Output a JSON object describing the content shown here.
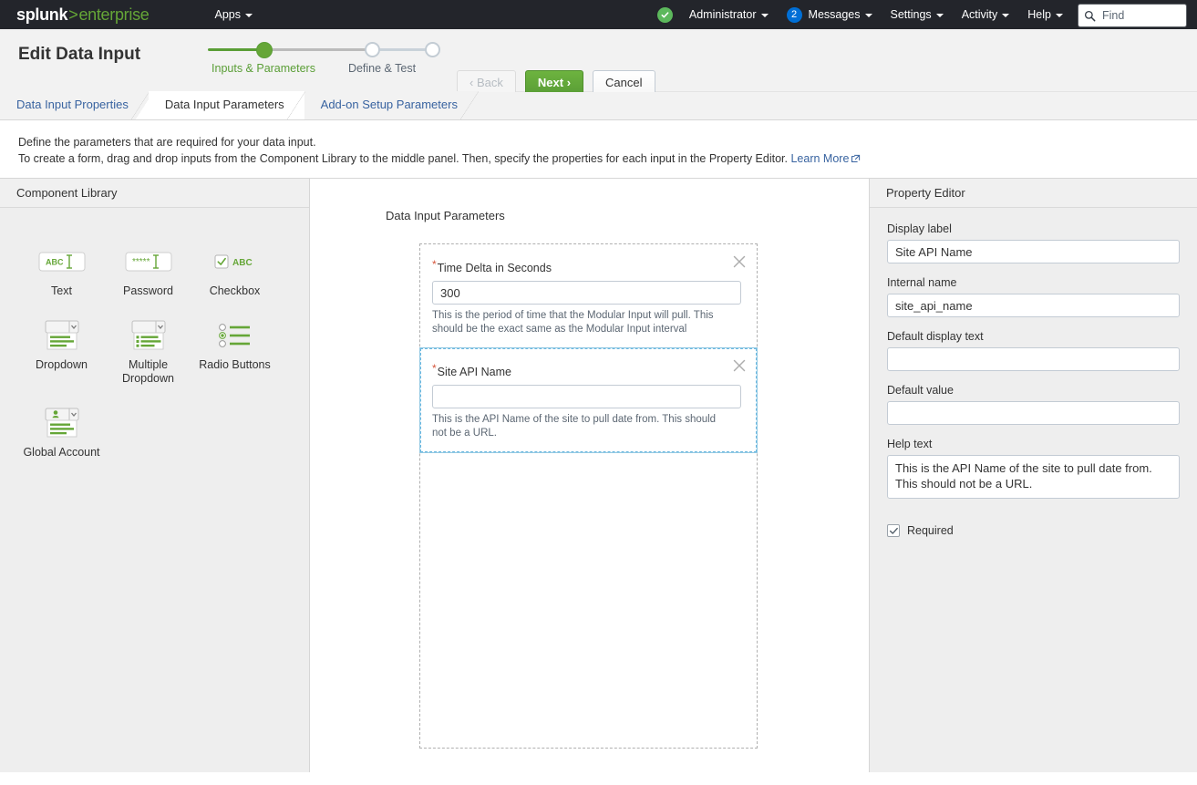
{
  "topbar": {
    "brand_splunk": "splunk",
    "brand_gt": ">",
    "brand_enterprise": "enterprise",
    "apps_label": "Apps",
    "health_icon": "health-check-icon",
    "administrator_label": "Administrator",
    "messages_count": "2",
    "messages_label": "Messages",
    "settings_label": "Settings",
    "activity_label": "Activity",
    "help_label": "Help",
    "find_placeholder": "Find",
    "find_value": "",
    "find_icon": "search-icon",
    "accent_green": "#65a637",
    "badge_blue": "#006fd6",
    "bar_bg": "#23252b"
  },
  "header": {
    "title": "Edit Data Input",
    "wizard": {
      "step_one_label": "Inputs & Parameters",
      "step_two_label": "Define & Test",
      "active_step": 1
    },
    "buttons": {
      "back": "Back",
      "next": "Next",
      "cancel": "Cancel",
      "back_chevron": "‹",
      "next_chevron": "›"
    }
  },
  "tabs": [
    {
      "label": "Data Input Properties",
      "active": false
    },
    {
      "label": "Data Input Parameters",
      "active": true
    },
    {
      "label": "Add-on Setup Parameters",
      "active": false
    }
  ],
  "description": {
    "line1": "Define the parameters that are required for your data input.",
    "line2": "To create a form, drag and drop inputs from the Component Library to the middle panel. Then, specify the properties for each input in the Property Editor.",
    "learn_more": "Learn More",
    "external_link_icon": "external-link-icon"
  },
  "component_library": {
    "title": "Component Library",
    "items": [
      {
        "label": "Text",
        "icon": "text-input-icon"
      },
      {
        "label": "Password",
        "icon": "password-input-icon"
      },
      {
        "label": "Checkbox",
        "icon": "checkbox-icon"
      },
      {
        "label": "Dropdown",
        "icon": "dropdown-icon"
      },
      {
        "label": "Multiple Dropdown",
        "icon": "multiple-dropdown-icon"
      },
      {
        "label": "Radio Buttons",
        "icon": "radio-buttons-icon"
      },
      {
        "label": "Global Account",
        "icon": "global-account-icon"
      }
    ]
  },
  "canvas": {
    "title": "Data Input Parameters",
    "fields": [
      {
        "label": "Time Delta in Seconds",
        "required": true,
        "value": "300",
        "placeholder": "",
        "help": "This is the period of time that the Modular Input will pull. This should be the exact same as the Modular Input interval",
        "selected": false,
        "remove_icon": "close-icon"
      },
      {
        "label": "Site API Name",
        "required": true,
        "value": "",
        "placeholder": "",
        "help": "This is the API Name of the site to pull date from. This should not be a URL.",
        "selected": true,
        "remove_icon": "close-icon"
      }
    ]
  },
  "property_editor": {
    "title": "Property Editor",
    "display_label_label": "Display label",
    "display_label_value": "Site API Name",
    "internal_name_label": "Internal name",
    "internal_name_value": "site_api_name",
    "default_display_text_label": "Default display text",
    "default_display_text_value": "",
    "default_value_label": "Default value",
    "default_value_value": "",
    "help_text_label": "Help text",
    "help_text_value": "This is the API Name of the site to pull date from. This should not be a URL.",
    "required_label": "Required",
    "required_checked": true
  }
}
